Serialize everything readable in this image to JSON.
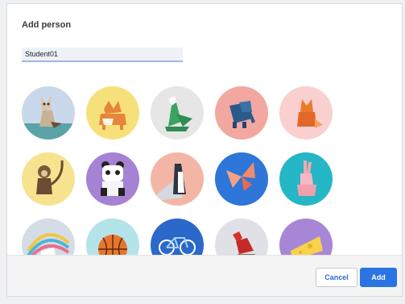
{
  "dialog": {
    "title": "Add person",
    "name_input_value": "Student01",
    "avatars": [
      {
        "name": "origami-cat",
        "bg": "#c9d8ea"
      },
      {
        "name": "origami-corgi",
        "bg": "#f6e07a"
      },
      {
        "name": "origami-dragon",
        "bg": "#e6e6e6"
      },
      {
        "name": "origami-elephant",
        "bg": "#f3a7a1"
      },
      {
        "name": "origami-fox",
        "bg": "#f9cfcf"
      },
      {
        "name": "origami-monkey",
        "bg": "#f7e38f"
      },
      {
        "name": "origami-panda",
        "bg": "#a582d3"
      },
      {
        "name": "origami-penguin",
        "bg": "#f3b6a6"
      },
      {
        "name": "origami-butterfly",
        "bg": "#2e76d8"
      },
      {
        "name": "origami-rabbit",
        "bg": "#25b7c5"
      },
      {
        "name": "origami-unicorn",
        "bg": "#d4dde6"
      },
      {
        "name": "basketball",
        "bg": "#b5e3ea"
      },
      {
        "name": "bicycle",
        "bg": "#2b68c9"
      },
      {
        "name": "origami-bird",
        "bg": "#dfe1e6"
      },
      {
        "name": "cheese",
        "bg": "#a886d6"
      }
    ],
    "buttons": {
      "cancel": "Cancel",
      "add": "Add"
    }
  },
  "colors": {
    "accent": "#2b74e3"
  }
}
